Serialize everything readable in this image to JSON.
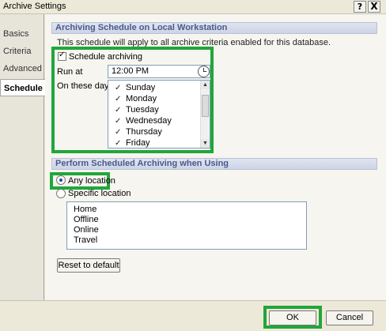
{
  "window": {
    "title": "Archive Settings",
    "help_glyph": "?",
    "close_glyph": "X"
  },
  "sidebar": {
    "items": [
      {
        "label": "Basics"
      },
      {
        "label": "Criteria"
      },
      {
        "label": "Advanced"
      },
      {
        "label": "Schedule"
      }
    ]
  },
  "schedule_section": {
    "header": "Archiving Schedule on Local Workstation",
    "description": "This schedule will apply to all archive criteria enabled for this database.",
    "schedule_checkbox": {
      "label": "Schedule archiving",
      "checked": true
    },
    "run_at_label": "Run at",
    "run_at_value": "12:00 PM",
    "days_label": "On these days",
    "check_glyph": "✓",
    "days": [
      {
        "label": "Sunday",
        "checked": true
      },
      {
        "label": "Monday",
        "checked": true
      },
      {
        "label": "Tuesday",
        "checked": true
      },
      {
        "label": "Wednesday",
        "checked": true
      },
      {
        "label": "Thursday",
        "checked": true
      },
      {
        "label": "Friday",
        "checked": true
      }
    ]
  },
  "location_section": {
    "header": "Perform Scheduled Archiving when Using",
    "any_location": {
      "label": "Any location",
      "selected": true
    },
    "specific_location": {
      "label": "Specific location",
      "selected": false
    },
    "locations": [
      "Home",
      "Offline",
      "Online",
      "Travel"
    ],
    "reset_label": "Reset to default"
  },
  "footer": {
    "ok_label": "OK",
    "cancel_label": "Cancel"
  },
  "colors": {
    "highlight": "#21a63b",
    "section_header_text": "#4a5a8a"
  }
}
